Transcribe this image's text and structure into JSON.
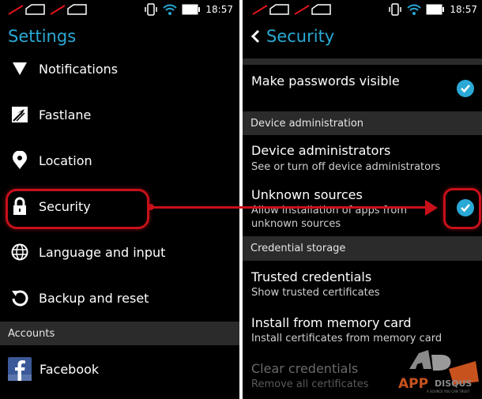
{
  "status_bar": {
    "time": "18:57",
    "icons": [
      "sim1-no-signal-icon",
      "sim2-no-signal-icon",
      "vibrate-icon",
      "wifi-icon",
      "battery-icon"
    ]
  },
  "left_screen": {
    "title": "Settings",
    "items": [
      {
        "label": "Notifications",
        "icon": "notifications-triangle-icon"
      },
      {
        "label": "Fastlane",
        "icon": "fastlane-arrow-icon"
      },
      {
        "label": "Location",
        "icon": "location-pin-icon"
      },
      {
        "label": "Security",
        "icon": "lock-icon",
        "highlighted": true
      },
      {
        "label": "Language and input",
        "icon": "globe-icon"
      },
      {
        "label": "Backup and reset",
        "icon": "restore-icon"
      }
    ],
    "accounts_header": "Accounts",
    "accounts": [
      {
        "label": "Facebook",
        "icon": "facebook-icon"
      }
    ]
  },
  "right_screen": {
    "title": "Security",
    "back_icon": "chevron-left-icon",
    "settings": [
      {
        "title": "Make passwords visible",
        "checked": true
      }
    ],
    "sections": [
      {
        "header": "Device administration",
        "items": [
          {
            "title": "Device administrators",
            "subtitle": "See or turn off device administrators"
          },
          {
            "title": "Unknown sources",
            "subtitle_line1": "Allow installation of apps from",
            "subtitle_line2": "unknown sources",
            "checked": true,
            "highlighted": true
          }
        ]
      },
      {
        "header": "Credential storage",
        "items": [
          {
            "title": "Trusted credentials",
            "subtitle": "Show trusted certificates"
          },
          {
            "title": "Install from memory card",
            "subtitle": "Install certificates from memory card"
          },
          {
            "title": "Clear credentials",
            "subtitle": "Remove all certificates",
            "disabled": true
          }
        ]
      }
    ]
  },
  "watermark": {
    "text_app": "APP",
    "text_disqus": "DISQUS",
    "tagline": "A SOURCE YOU CAN TRUST",
    "colors": {
      "orange": "#c8521e",
      "gray": "#8a8a8a"
    }
  },
  "colors": {
    "accent": "#2aa9d6",
    "highlight_red": "#c8101a",
    "section_bg": "#2b2b2b",
    "facebook_blue": "#3b5998"
  }
}
